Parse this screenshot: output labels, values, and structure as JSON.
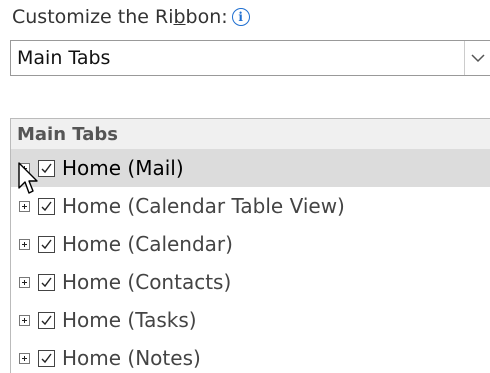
{
  "heading": {
    "text_pre": "Customize the Ri",
    "text_ul": "b",
    "text_post": "bon:",
    "info_icon": "info-icon"
  },
  "tabs_dropdown": {
    "value": "Main Tabs",
    "arrow_icon": "chevron-down-icon"
  },
  "tree": {
    "header": "Main Tabs",
    "rows": [
      {
        "label": "Home (Mail)",
        "checked": true,
        "selected": true
      },
      {
        "label": "Home (Calendar Table View)",
        "checked": true,
        "selected": false
      },
      {
        "label": "Home (Calendar)",
        "checked": true,
        "selected": false
      },
      {
        "label": "Home (Contacts)",
        "checked": true,
        "selected": false
      },
      {
        "label": "Home (Tasks)",
        "checked": true,
        "selected": false
      },
      {
        "label": "Home (Notes)",
        "checked": true,
        "selected": false
      }
    ]
  },
  "colors": {
    "selected_row": "#dcdcdc",
    "info_accent": "#1f6fd1"
  }
}
